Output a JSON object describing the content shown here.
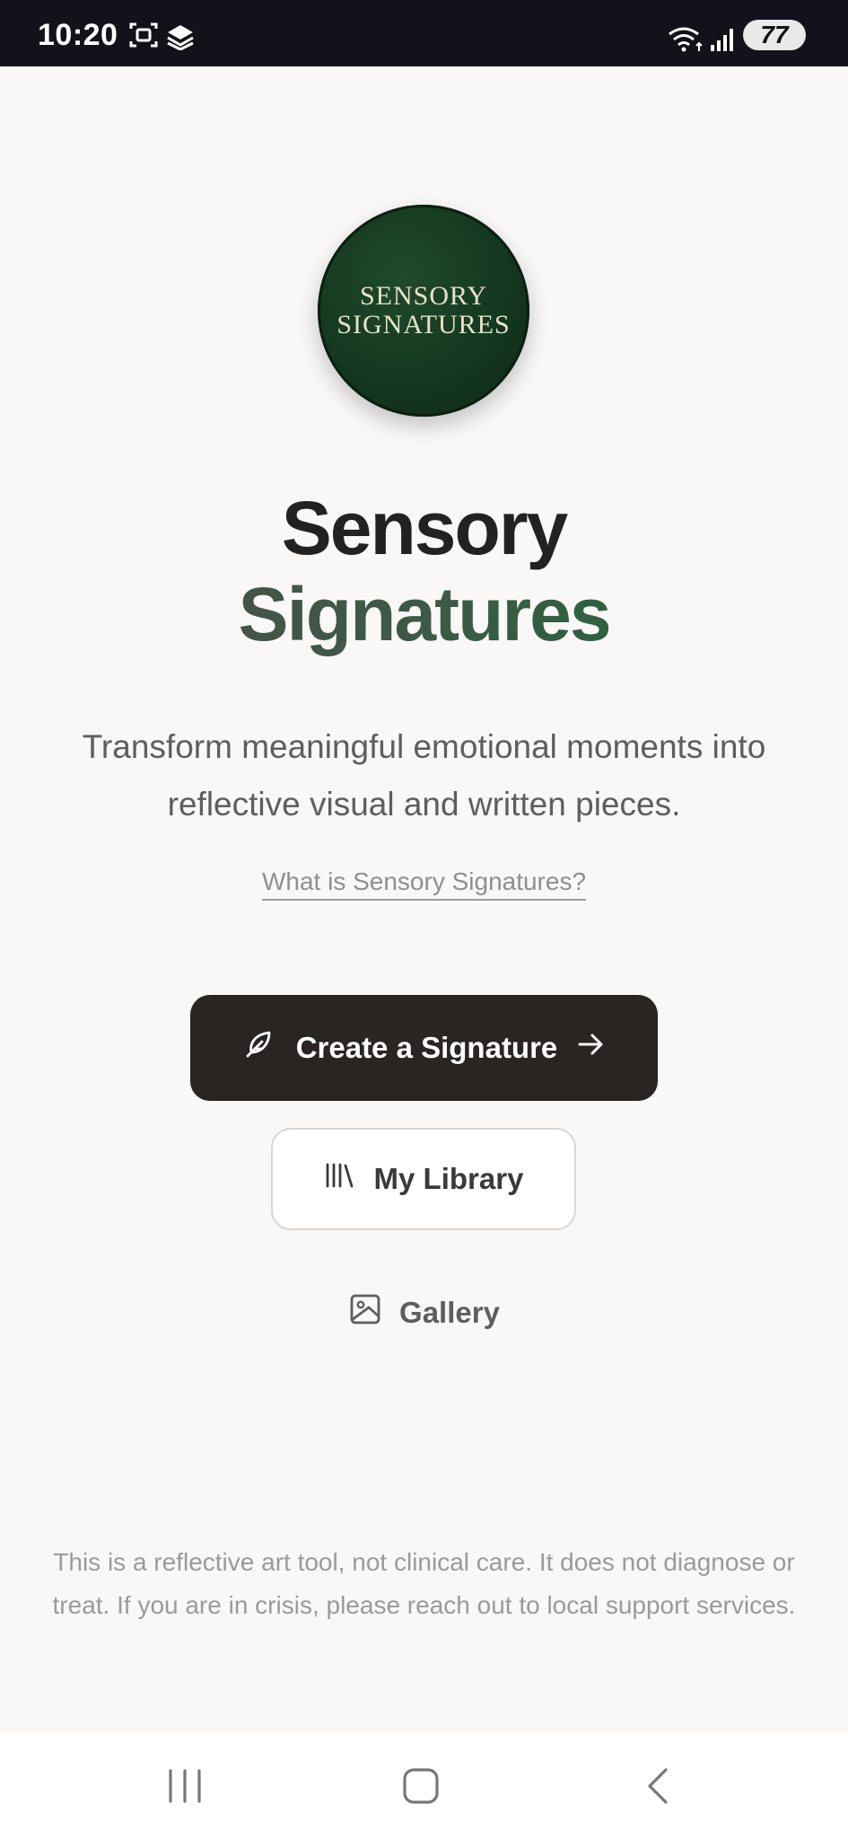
{
  "status_bar": {
    "time": "10:20",
    "battery": "77",
    "icons": [
      "screenshot-icon",
      "stack-icon",
      "wifi-icon",
      "signal-icon",
      "battery-icon"
    ]
  },
  "logo": {
    "line1": "SENSORY",
    "line2": "SIGNATURES"
  },
  "title": {
    "line1": "Sensory",
    "line2": "Signatures"
  },
  "tagline": "Transform meaningful emotional moments into reflective visual and written pieces.",
  "what_link": "What is Sensory Signatures?",
  "actions": {
    "create_label": "Create a Signature",
    "library_label": "My Library",
    "gallery_label": "Gallery"
  },
  "disclaimer": "This is a reflective art tool, not clinical care. It does not diagnose or treat. If you are in crisis, please reach out to local support services.",
  "colors": {
    "primary_button": "#2a2423",
    "accent_green": "#1f6a3c",
    "background": "#f9f8f6"
  }
}
